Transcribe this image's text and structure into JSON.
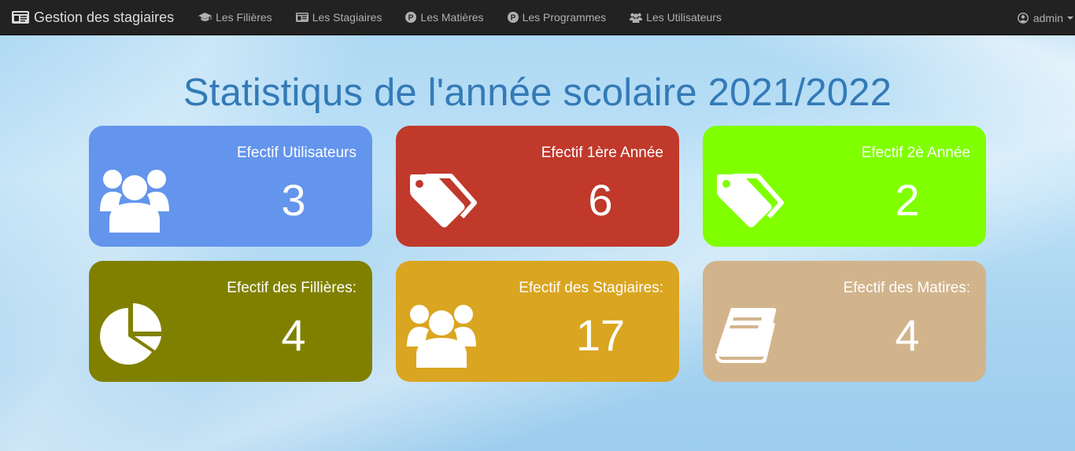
{
  "navbar": {
    "brand": "Gestion des stagiaires",
    "brand_icon": "id-card-icon",
    "items": [
      {
        "label": "Les Filières",
        "icon": "graduation-cap-icon"
      },
      {
        "label": "Les Stagiaires",
        "icon": "id-card-icon"
      },
      {
        "label": "Les Matières",
        "icon": "p-circle-icon"
      },
      {
        "label": "Les Programmes",
        "icon": "p-circle-icon"
      },
      {
        "label": "Les Utilisateurs",
        "icon": "users-icon"
      }
    ],
    "user": {
      "label": "admin",
      "icon": "user-circle-icon"
    }
  },
  "page": {
    "title": "Statistiqus de l'année scolaire 2021/2022"
  },
  "cards": [
    {
      "label": "Efectif Utilisateurs",
      "value": "3",
      "icon": "users-icon",
      "color": "#6495ed"
    },
    {
      "label": "Efectif 1ère Année",
      "value": "6",
      "icon": "tags-icon",
      "color": "#c0392b"
    },
    {
      "label": "Efectif 2è Année",
      "value": "2",
      "icon": "tags-icon",
      "color": "#7fff00"
    },
    {
      "label": "Efectif des Fillières:",
      "value": "4",
      "icon": "pie-chart-icon",
      "color": "#808000"
    },
    {
      "label": "Efectif des Stagiaires:",
      "value": "17",
      "icon": "users-icon",
      "color": "#daa520"
    },
    {
      "label": "Efectif des Matires:",
      "value": "4",
      "icon": "book-icon",
      "color": "#d2b48c"
    }
  ]
}
